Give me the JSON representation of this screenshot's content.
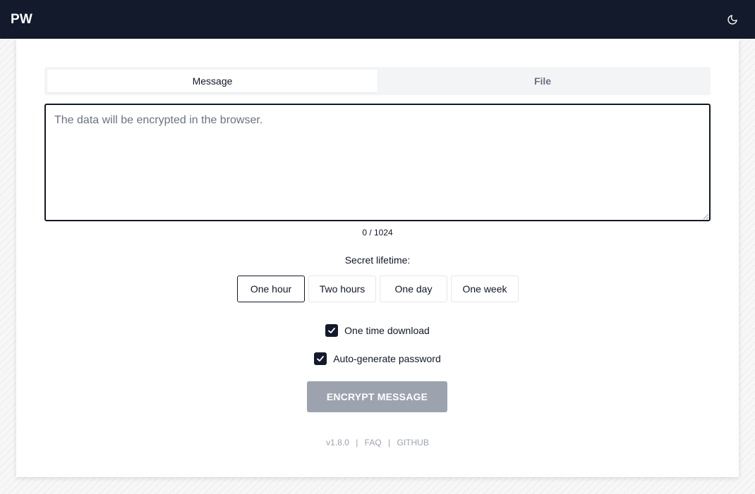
{
  "header": {
    "logo": "PW",
    "theme_toggle_icon": "moon-icon"
  },
  "tabs": [
    {
      "label": "Message",
      "active": true
    },
    {
      "label": "File",
      "active": false
    }
  ],
  "message": {
    "value": "",
    "placeholder": "The data will be encrypted in the browser.",
    "counter": "0 / 1024"
  },
  "lifetime": {
    "label": "Secret lifetime:",
    "options": [
      "One hour",
      "Two hours",
      "One day",
      "One week"
    ],
    "selected": "One hour"
  },
  "options": {
    "one_time_download": {
      "label": "One time download",
      "checked": true
    },
    "auto_generate_password": {
      "label": "Auto-generate password",
      "checked": true
    }
  },
  "encrypt_button": {
    "label": "ENCRYPT MESSAGE",
    "disabled": true
  },
  "footer": {
    "version": "v1.8.0",
    "separator": "|",
    "faq": "FAQ",
    "github": "GITHUB"
  },
  "colors": {
    "header_bg": "#121a2b",
    "button_disabled_bg": "#9ca3af",
    "checkbox_bg": "#121a2b"
  }
}
